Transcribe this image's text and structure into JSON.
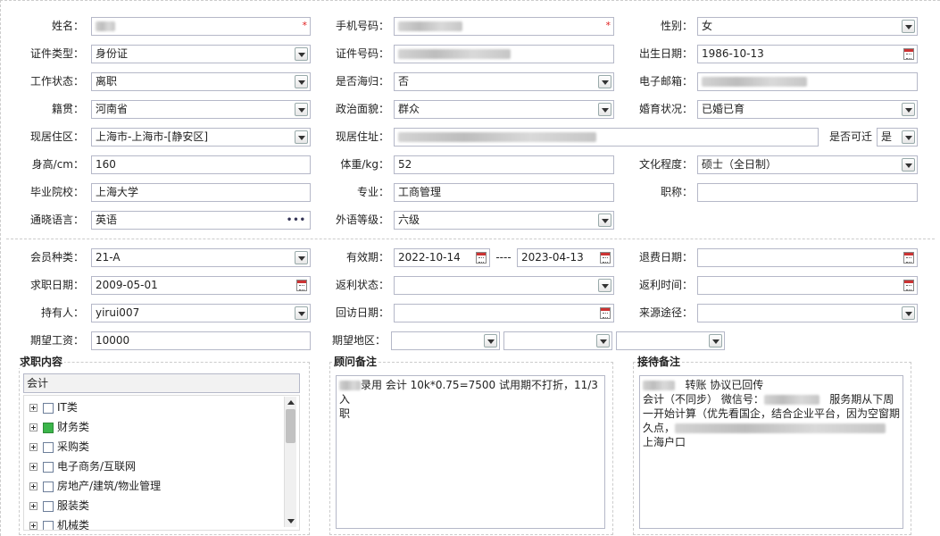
{
  "personal": {
    "name": {
      "label": "姓名：",
      "required_mark": "*"
    },
    "phone": {
      "label": "手机号码：",
      "required_mark": "*"
    },
    "gender": {
      "label": "性别：",
      "value": "女"
    },
    "id_type": {
      "label": "证件类型：",
      "value": "身份证"
    },
    "id_number": {
      "label": "证件号码："
    },
    "birth_date": {
      "label": "出生日期：",
      "value": "1986-10-13"
    },
    "work_status": {
      "label": "工作状态：",
      "value": "离职"
    },
    "overseas_returnee": {
      "label": "是否海归：",
      "value": "否"
    },
    "email": {
      "label": "电子邮箱："
    },
    "native_place": {
      "label": "籍贯：",
      "value": "河南省"
    },
    "political_status": {
      "label": "政治面貌：",
      "value": "群众"
    },
    "marital_status": {
      "label": "婚育状况：",
      "value": "已婚已育"
    },
    "current_area": {
      "label": "现居住区：",
      "value": "上海市-上海市-[静安区]"
    },
    "current_address": {
      "label": "现居住址："
    },
    "relocatable": {
      "label": "是否可迁",
      "value": "是"
    },
    "height": {
      "label": "身高/cm：",
      "value": "160"
    },
    "weight": {
      "label": "体重/kg：",
      "value": "52"
    },
    "education": {
      "label": "文化程度：",
      "value": "硕士（全日制）"
    },
    "school": {
      "label": "毕业院校：",
      "value": "上海大学"
    },
    "major": {
      "label": "专业：",
      "value": "工商管理"
    },
    "title": {
      "label": "职称：",
      "value": ""
    },
    "languages": {
      "label": "通晓语言：",
      "value": "英语"
    },
    "foreign_level": {
      "label": "外语等级：",
      "value": "六级"
    }
  },
  "membership": {
    "member_type": {
      "label": "会员种类：",
      "value": "21-A"
    },
    "valid_period": {
      "label": "有效期：",
      "start": "2022-10-14",
      "separator": "----",
      "end": "2023-04-13"
    },
    "refund_date": {
      "label": "退费日期：",
      "value": ""
    },
    "job_seek_date": {
      "label": "求职日期：",
      "value": "2009-05-01"
    },
    "rebate_status": {
      "label": "返利状态：",
      "value": ""
    },
    "rebate_time": {
      "label": "返利时间：",
      "value": ""
    },
    "holder": {
      "label": "持有人：",
      "value": "yirui007"
    },
    "followup_date": {
      "label": "回访日期：",
      "value": ""
    },
    "source": {
      "label": "来源途径：",
      "value": ""
    },
    "expected_salary": {
      "label": "期望工资：",
      "value": "10000"
    },
    "expected_area": {
      "label": "期望地区："
    }
  },
  "job_content": {
    "title": "求职内容",
    "selected_value": "会计",
    "items": [
      {
        "label": "IT类",
        "checked": false
      },
      {
        "label": "财务类",
        "checked": true
      },
      {
        "label": "采购类",
        "checked": false
      },
      {
        "label": "电子商务/互联网",
        "checked": false
      },
      {
        "label": "房地产/建筑/物业管理",
        "checked": false
      },
      {
        "label": "服装类",
        "checked": false
      },
      {
        "label": "机械类",
        "checked": false
      }
    ]
  },
  "consultant_notes": {
    "title": "顾问备注",
    "line1": "录用  会计 10k*0.75=7500 试用期不打折，11/3入",
    "line2": "职"
  },
  "reception_notes": {
    "title": "接待备注",
    "line1": "转账 协议已回传",
    "line2a": "会计（不同步） 微信号：",
    "line2b": "服务期从下周",
    "line3": "一开始计算（优先看国企，结合企业平台，因为空窗期",
    "line4": "久点，",
    "line5": "上海户口"
  },
  "colors": {
    "border": "#b5b8c8",
    "required": "#e02020",
    "checked": "#3bb54a"
  }
}
